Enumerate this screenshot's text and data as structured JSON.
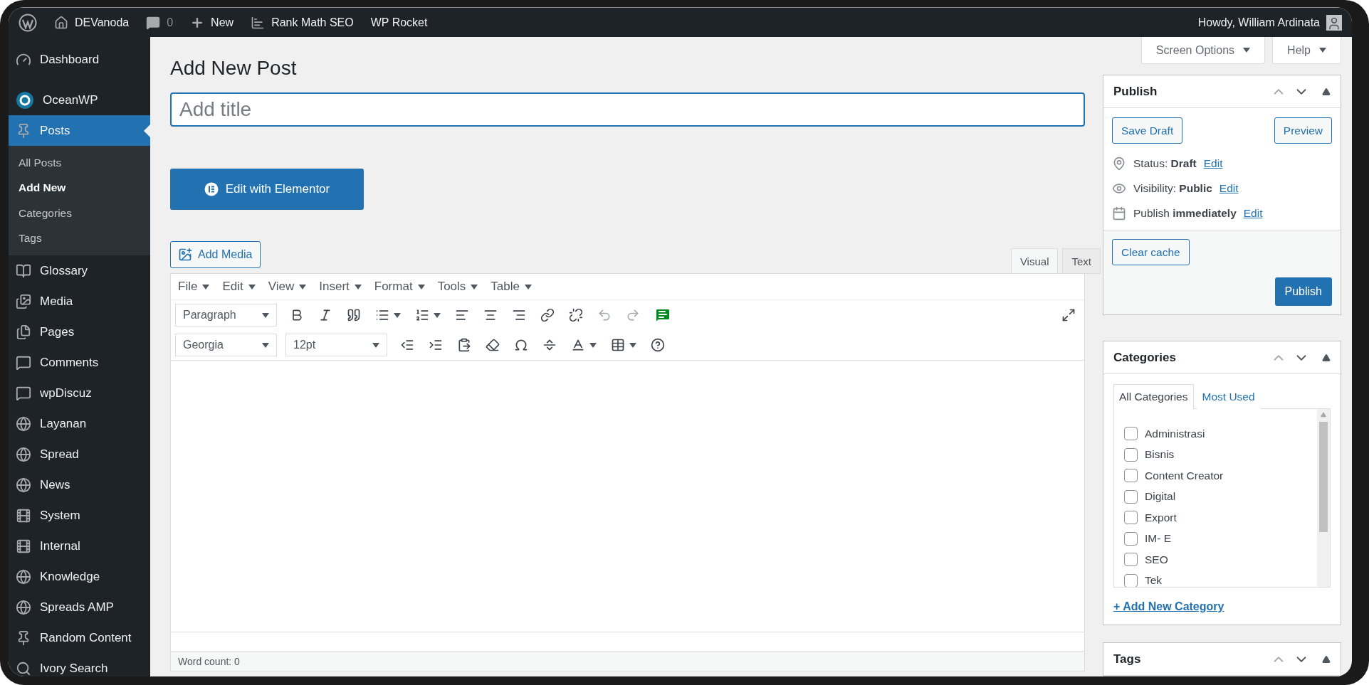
{
  "admin_bar": {
    "site_name": "DEVanoda",
    "comments_count": "0",
    "new_label": "New",
    "items": [
      "Rank Math SEO",
      "WP Rocket"
    ],
    "greeting": "Howdy, William Ardinata"
  },
  "sidebar": {
    "items": [
      {
        "label": "Dashboard",
        "selected": false
      },
      {
        "label": "OceanWP",
        "selected": false
      },
      {
        "label": "Posts",
        "selected": true,
        "children": [
          {
            "label": "All Posts",
            "selected": false
          },
          {
            "label": "Add New",
            "selected": true
          },
          {
            "label": "Categories",
            "selected": false
          },
          {
            "label": "Tags",
            "selected": false
          }
        ]
      },
      {
        "label": "Glossary",
        "selected": false
      },
      {
        "label": "Media",
        "selected": false
      },
      {
        "label": "Pages",
        "selected": false
      },
      {
        "label": "Comments",
        "selected": false
      },
      {
        "label": "wpDiscuz",
        "selected": false
      },
      {
        "label": "Layanan",
        "selected": false
      },
      {
        "label": "Spread",
        "selected": false
      },
      {
        "label": "News",
        "selected": false
      },
      {
        "label": "System",
        "selected": false
      },
      {
        "label": "Internal",
        "selected": false
      },
      {
        "label": "Knowledge",
        "selected": false
      },
      {
        "label": "Spreads AMP",
        "selected": false
      },
      {
        "label": "Random Content",
        "selected": false
      },
      {
        "label": "Ivory Search",
        "selected": false
      }
    ]
  },
  "header_buttons": [
    "Screen Options",
    "Help"
  ],
  "page_title": "Add New Post",
  "title_field": {
    "placeholder": "Add title"
  },
  "elementor_button": "Edit with Elementor",
  "add_media": "Add Media",
  "editor": {
    "tabs": [
      {
        "label": "Visual",
        "selected": true
      },
      {
        "label": "Text",
        "selected": false
      }
    ],
    "menus": [
      "File",
      "Edit",
      "View",
      "Insert",
      "Format",
      "Tools",
      "Table"
    ],
    "format_select": "Paragraph",
    "font_select": "Georgia",
    "size_select": "12pt",
    "word_count": "Word count: 0"
  },
  "publish": {
    "title": "Publish",
    "save_draft": "Save Draft",
    "preview": "Preview",
    "rows": [
      {
        "text": "Status: **Draft**",
        "link": "Edit"
      },
      {
        "text": "Visibility: **Public**",
        "link": "Edit"
      },
      {
        "text": "Publish **immediately**",
        "link": "Edit"
      }
    ],
    "clear_cache": "Clear cache",
    "publish_button": "Publish"
  },
  "categories": {
    "title": "Categories",
    "tabs": [
      {
        "label": "All Categories",
        "selected": true
      },
      {
        "label": "Most Used",
        "selected": false
      }
    ],
    "items": [
      {
        "label": "Administrasi",
        "checked": false
      },
      {
        "label": "Bisnis",
        "checked": false
      },
      {
        "label": "Content Creator",
        "checked": false
      },
      {
        "label": "Digital",
        "checked": false
      },
      {
        "label": "Export",
        "checked": false
      },
      {
        "label": "IM- E",
        "checked": false
      },
      {
        "label": "SEO",
        "checked": false
      },
      {
        "label": "Tek",
        "checked": false
      }
    ],
    "add_link": "+ Add New Category"
  },
  "tags": {
    "title": "Tags"
  }
}
